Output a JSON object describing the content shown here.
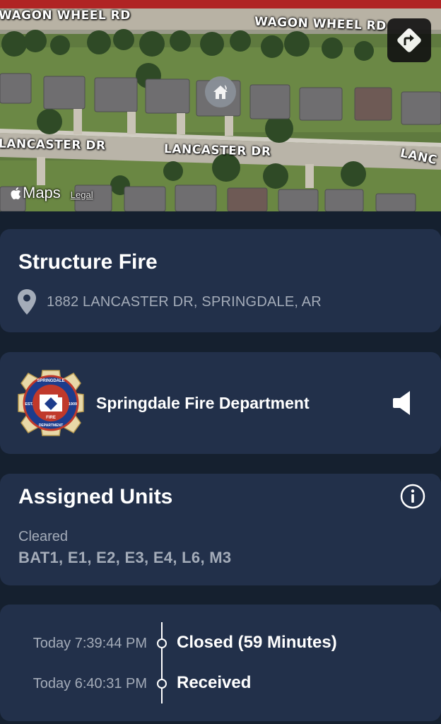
{
  "map": {
    "roads": [
      "WAGON WHEEL RD",
      "WAGON WHEEL RD",
      "LANCASTER DR",
      "LANCASTER DR",
      "LANC"
    ],
    "attribution": {
      "brand": "Maps",
      "legal": "Legal"
    },
    "colors": {
      "grass": "#5f7a3f",
      "road": "#b8b2a4",
      "roof": "#6f6e70"
    }
  },
  "incident": {
    "type": "Structure Fire",
    "address": "1882 LANCASTER DR, SPRINGDALE, AR"
  },
  "department": {
    "name": "Springdale Fire Department",
    "badge": {
      "top": "SPRINGDALE",
      "left": "EST.",
      "right": "1909",
      "fire": "FIRE",
      "bottom": "DEPARTMENT"
    }
  },
  "units": {
    "title": "Assigned Units",
    "status": "Cleared",
    "list": "BAT1, E1, E2, E3, E4, L6, M3"
  },
  "timeline": [
    {
      "time": "Today 7:39:44 PM",
      "event": "Closed (59 Minutes)"
    },
    {
      "time": "Today 6:40:31 PM",
      "event": "Received"
    }
  ],
  "theme": {
    "background": "#15202f",
    "card": "#22304a",
    "secondary_text": "#a4acb9",
    "top_bar": "#b02424"
  }
}
